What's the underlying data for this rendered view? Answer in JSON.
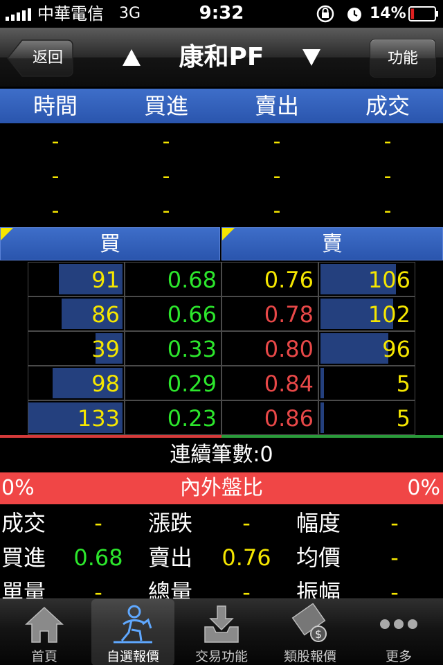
{
  "status_bar": {
    "carrier": "中華電信",
    "network": "3G",
    "time": "9:32",
    "battery": "14%",
    "battery_level": 0.14
  },
  "nav": {
    "back_label": "返回",
    "title": "康和PF",
    "function_label": "功能"
  },
  "trades": {
    "headers": [
      "時間",
      "買進",
      "賣出",
      "成交"
    ],
    "rows": [
      [
        "-",
        "-",
        "-",
        "-"
      ],
      [
        "-",
        "-",
        "-",
        "-"
      ],
      [
        "-",
        "-",
        "-",
        "-"
      ]
    ]
  },
  "book": {
    "bid_label": "買",
    "ask_label": "賣",
    "rows": [
      {
        "bid_qty": "91",
        "bid_price": "0.68",
        "ask_price": "0.76",
        "ask_qty": "106",
        "bid_fill": 0.68,
        "ask_fill": 0.8,
        "ask_price_color": "yellow"
      },
      {
        "bid_qty": "86",
        "bid_price": "0.66",
        "ask_price": "0.78",
        "ask_qty": "102",
        "bid_fill": 0.65,
        "ask_fill": 0.77,
        "ask_price_color": "red"
      },
      {
        "bid_qty": "39",
        "bid_price": "0.33",
        "ask_price": "0.80",
        "ask_qty": "96",
        "bid_fill": 0.29,
        "ask_fill": 0.72,
        "ask_price_color": "red"
      },
      {
        "bid_qty": "98",
        "bid_price": "0.29",
        "ask_price": "0.84",
        "ask_qty": "5",
        "bid_fill": 0.74,
        "ask_fill": 0.04,
        "ask_price_color": "red"
      },
      {
        "bid_qty": "133",
        "bid_price": "0.23",
        "ask_price": "0.86",
        "ask_qty": "5",
        "bid_fill": 1.0,
        "ask_fill": 0.04,
        "ask_price_color": "red"
      }
    ]
  },
  "consecutive": "連續筆數:0",
  "ratio": {
    "left": "0%",
    "label": "內外盤比",
    "right": "0%"
  },
  "stats": [
    [
      {
        "label": "成交",
        "value": "-",
        "color": "yellow"
      },
      {
        "label": "漲跌",
        "value": "-",
        "color": "yellow"
      },
      {
        "label": "幅度",
        "value": "-",
        "color": "yellow"
      }
    ],
    [
      {
        "label": "買進",
        "value": "0.68",
        "color": "green"
      },
      {
        "label": "賣出",
        "value": "0.76",
        "color": "yellow"
      },
      {
        "label": "均價",
        "value": "-",
        "color": "yellow"
      }
    ],
    [
      {
        "label": "單量",
        "value": "-",
        "color": "yellow"
      },
      {
        "label": "總量",
        "value": "-",
        "color": "yellow"
      },
      {
        "label": "振幅",
        "value": "-",
        "color": "yellow"
      }
    ]
  ],
  "tabs": [
    {
      "label": "首頁",
      "icon": "home-icon"
    },
    {
      "label": "自選報價",
      "icon": "person-chart-icon",
      "active": true
    },
    {
      "label": "交易功能",
      "icon": "download-tray-icon"
    },
    {
      "label": "類股報價",
      "icon": "film-dollar-icon"
    },
    {
      "label": "更多",
      "icon": "more-dots-icon"
    }
  ],
  "colors": {
    "header_blue": "#2a55ad",
    "bar_blue": "#24407e",
    "price_green": "#2ce62c",
    "price_red": "#e84848",
    "value_yellow": "#f5e600",
    "ratio_red": "#f04646"
  }
}
